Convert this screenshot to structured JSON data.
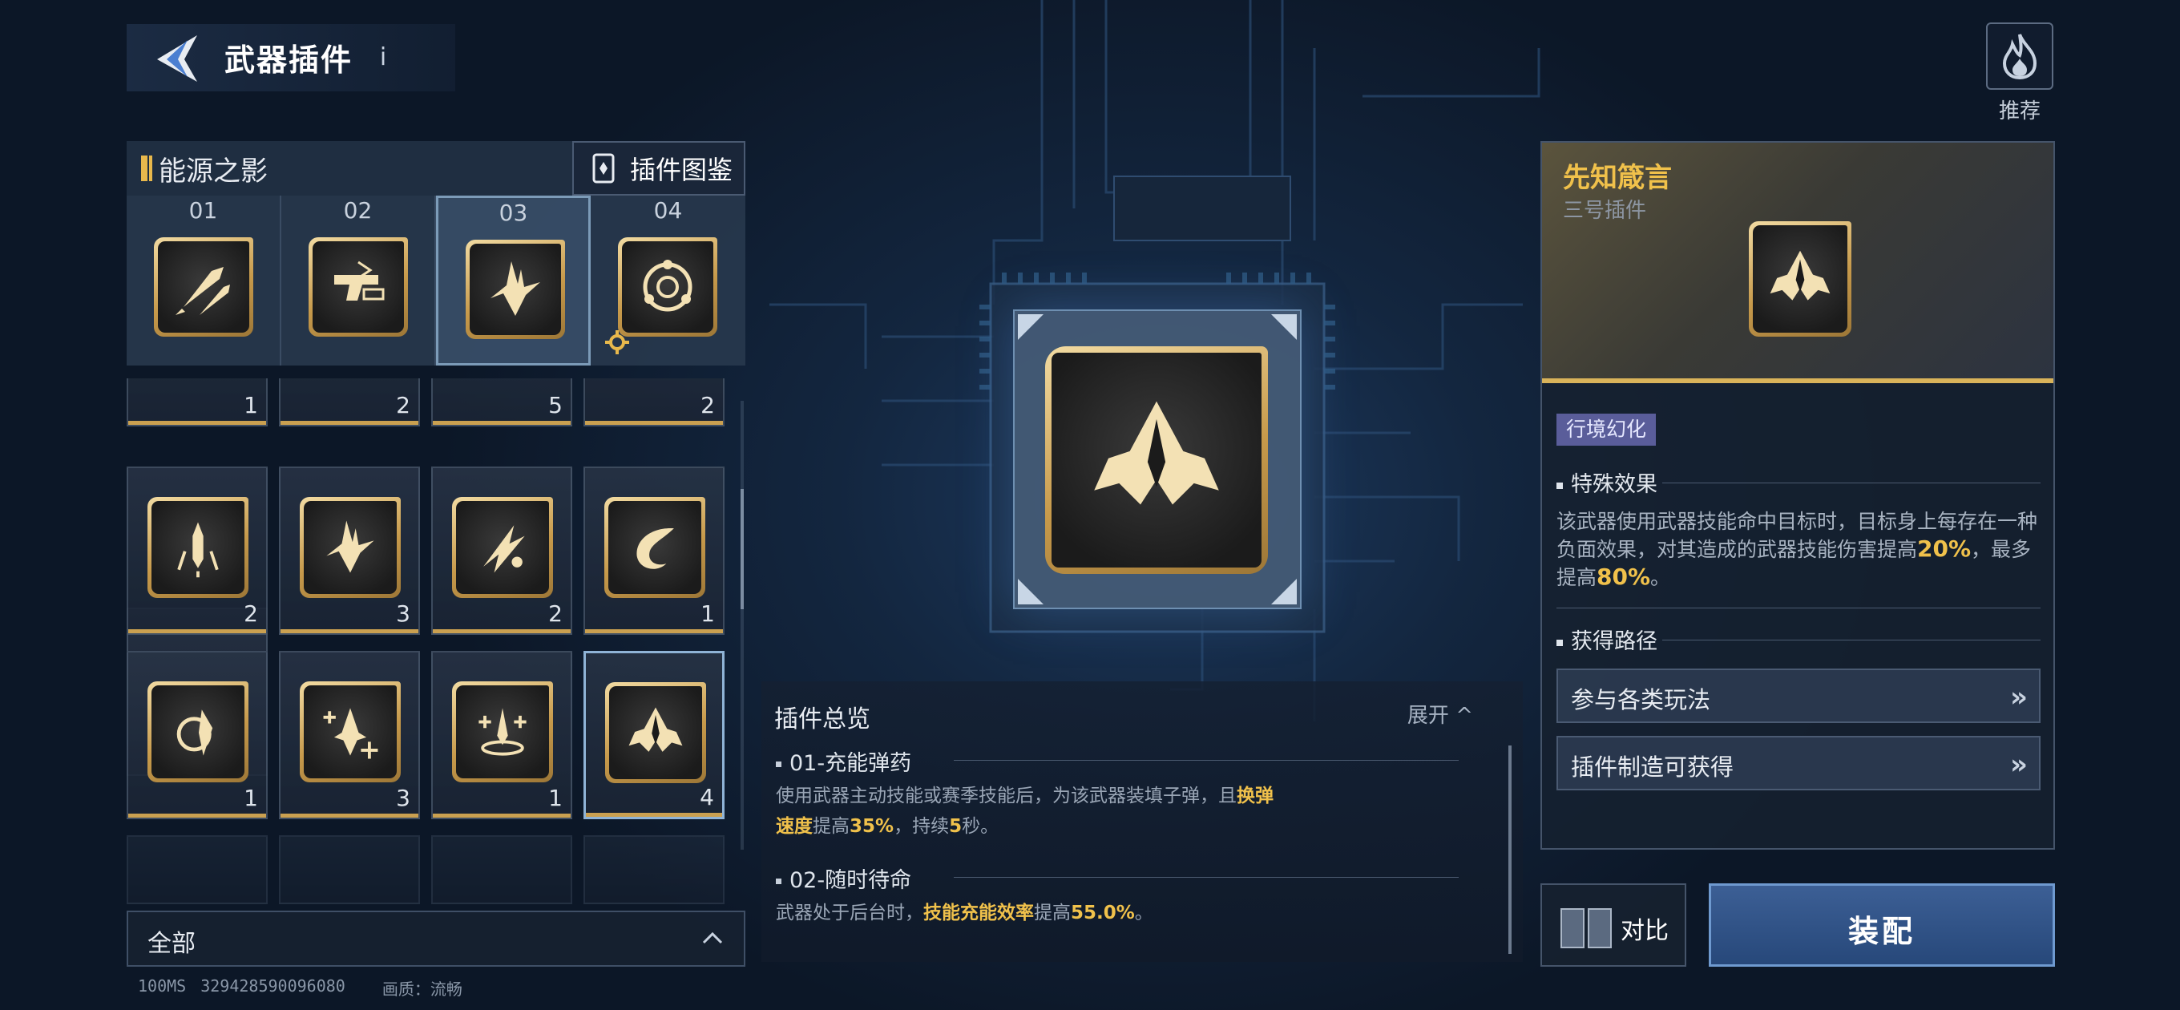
{
  "header": {
    "title": "武器插件",
    "info_label": "i"
  },
  "recommend": {
    "label": "推荐",
    "icon": "flame-icon"
  },
  "set": {
    "title": "能源之影",
    "codex_label": "插件图鉴"
  },
  "slots": [
    {
      "num": "01",
      "icon": "rocket-icon"
    },
    {
      "num": "02",
      "icon": "gun-icon"
    },
    {
      "num": "03",
      "icon": "burst-icon"
    },
    {
      "num": "04",
      "icon": "ring-icon"
    }
  ],
  "grid": {
    "row0": [
      "1",
      "2",
      "5",
      "2"
    ],
    "row1": [
      "2",
      "3",
      "2",
      "1"
    ],
    "row2": [
      "1",
      "3",
      "1",
      "4"
    ]
  },
  "filter": {
    "label": "全部"
  },
  "status": {
    "ping": "100MS",
    "id": "329428590096080",
    "quality": "画质：流畅"
  },
  "overview": {
    "title": "插件总览",
    "expand_label": "展开",
    "sec1_title": "01-充能弹药",
    "sec1_text_a": "使用武器主动技能或赛季技能后，为该武器装填子弹，且",
    "sec1_hl1": "换弹",
    "sec1_hl2": "速度",
    "sec1_text_b": "提高",
    "sec1_hl3": "35%",
    "sec1_text_c": "，持续",
    "sec1_hl4": "5",
    "sec1_text_d": "秒。",
    "sec2_title": "02-随时待命",
    "sec2_text_a": "武器处于后台时，",
    "sec2_hl1": "技能充能效率",
    "sec2_text_b": "提高",
    "sec2_hl2": "55.0%",
    "sec2_text_c": "。"
  },
  "detail": {
    "name": "先知箴言",
    "subtitle": "三号插件",
    "tag": "行境幻化",
    "effect_title": "特殊效果",
    "effect_text_a": "该武器使用武器技能命中目标时，目标身上每存在一种负面效果，对其造成的武器技能伤害提高",
    "effect_hl1": "20%",
    "effect_text_b": "，最多提高",
    "effect_hl2": "80%",
    "effect_text_c": "。",
    "route_title": "获得路径",
    "route1": "参与各类玩法",
    "route2": "插件制造可获得",
    "route_arrow": "»"
  },
  "actions": {
    "compare_label": "对比",
    "equip_label": "装配"
  },
  "colors": {
    "gold": "#f0c14b",
    "accent_blue": "#3c5f95",
    "tag_purple": "#5a5d9a"
  }
}
